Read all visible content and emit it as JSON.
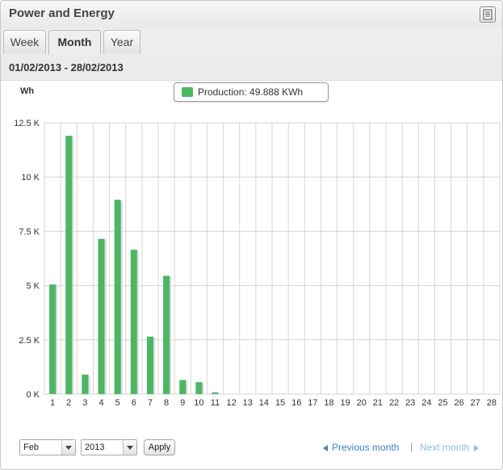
{
  "widget": {
    "title": "Power and Energy",
    "export_icon": "export-document-icon"
  },
  "tabs": [
    {
      "label": "Week",
      "active": false
    },
    {
      "label": "Month",
      "active": true
    },
    {
      "label": "Year",
      "active": false
    }
  ],
  "date_range": "01/02/2013 - 28/02/2013",
  "unit_label": "Wh",
  "legend": {
    "label": "Production: 49.888 KWh",
    "color": "#49b763"
  },
  "chart_data": {
    "type": "bar",
    "categories": [
      "1",
      "2",
      "3",
      "4",
      "5",
      "6",
      "7",
      "8",
      "9",
      "10",
      "11",
      "12",
      "13",
      "14",
      "15",
      "16",
      "17",
      "18",
      "19",
      "20",
      "21",
      "22",
      "23",
      "24",
      "25",
      "26",
      "27",
      "28"
    ],
    "series": [
      {
        "name": "Production",
        "values": [
          5050,
          11900,
          900,
          7150,
          8950,
          6650,
          2650,
          5450,
          650,
          550,
          80,
          0,
          0,
          0,
          0,
          0,
          0,
          0,
          0,
          0,
          0,
          0,
          0,
          0,
          0,
          0,
          0,
          0
        ]
      }
    ],
    "y_ticks": [
      {
        "value": 0,
        "label": "0 K"
      },
      {
        "value": 2500,
        "label": "2.5 K"
      },
      {
        "value": 5000,
        "label": "5 K"
      },
      {
        "value": 7500,
        "label": "7.5 K"
      },
      {
        "value": 10000,
        "label": "10 K"
      },
      {
        "value": 12500,
        "label": "12.5 K"
      }
    ],
    "ylim": [
      0,
      12500
    ],
    "grid": true,
    "bar_color": "#49b763"
  },
  "controls": {
    "month_value": "Feb",
    "year_value": "2013",
    "apply_label": "Apply",
    "prev_label": "Previous month",
    "separator": "|",
    "next_label": "Next month"
  }
}
